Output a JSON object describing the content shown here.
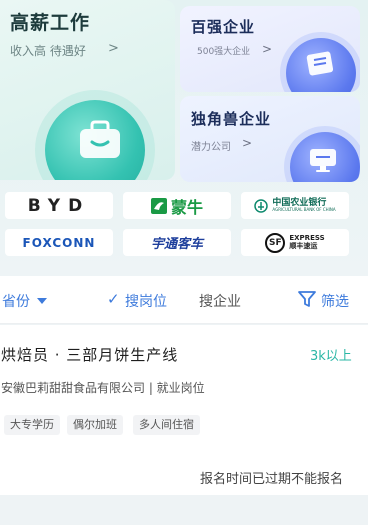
{
  "categories": {
    "high_pay": {
      "title": "高薪工作",
      "subtitle": "收入高  待遇好",
      "arrow": ">"
    },
    "top500": {
      "title": "百强企业",
      "subtitle": "500强大企业",
      "arrow": ">"
    },
    "unicorn": {
      "title": "独角兽企业",
      "subtitle": "潜力公司",
      "arrow": ">"
    }
  },
  "company_logos": [
    {
      "name": "BYD",
      "text": "BYD"
    },
    {
      "name": "蒙牛",
      "text": "蒙牛"
    },
    {
      "name": "中国农业银行",
      "text": "中国农业银行",
      "sub": "AGRICULTURAL BANK OF CHINA"
    },
    {
      "name": "FOXCONN",
      "text": "FOXCONN"
    },
    {
      "name": "宇通客车",
      "text": "宇通客车"
    },
    {
      "name": "SF EXPRESS",
      "text": "SF",
      "sub1": "EXPRESS",
      "sub2": "顺丰速运"
    }
  ],
  "filter_bar": {
    "province": "省份",
    "check_mark": "✓",
    "search_jobs": "搜岗位",
    "search_companies": "搜企业",
    "filter": "筛选"
  },
  "job": {
    "title": "烘焙员 · 三部月饼生产线",
    "salary": "3k以上",
    "company": "安徽巴莉甜甜食品有限公司 | 就业岗位",
    "tags": [
      "大专学历",
      "偶尔加班",
      "多人间住宿"
    ],
    "status": "报名时间已过期不能报名"
  },
  "colors": {
    "accent_blue": "#3e7bdc",
    "salary_teal": "#2bb7a6",
    "teal_circle": "#34c2b1",
    "blue_circle": "#5b78ee"
  }
}
